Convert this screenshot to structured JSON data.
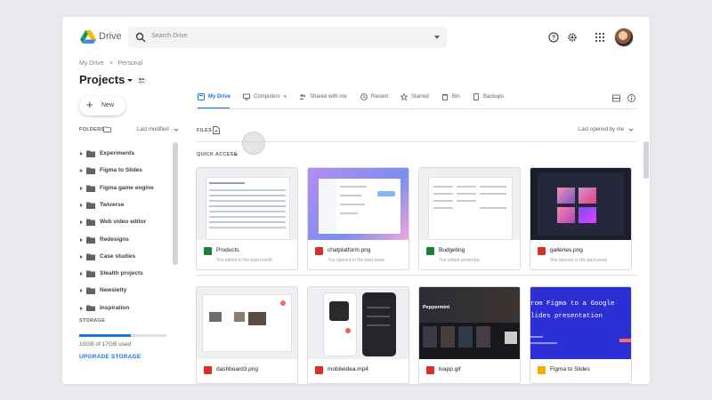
{
  "app": {
    "brand": "Drive",
    "search_placeholder": "Search Drive"
  },
  "toolbar": {
    "icons": [
      "help-icon",
      "settings-icon",
      "apps-grid-icon"
    ],
    "avatar": "user-avatar"
  },
  "breadcrumb": {
    "root": "My Drive",
    "separator": ">",
    "current": "Personal"
  },
  "page": {
    "title": "Projects"
  },
  "new_button": {
    "label": "New"
  },
  "sidebar": {
    "folders_header": "FOLDERS",
    "sort_label": "Last modified",
    "folders": [
      {
        "label": "Experiments"
      },
      {
        "label": "Figma to Slides"
      },
      {
        "label": "Figma game engine"
      },
      {
        "label": "Twiverse"
      },
      {
        "label": "Web video editor"
      },
      {
        "label": "Redesigns"
      },
      {
        "label": "Case studies"
      },
      {
        "label": "Stealth projects"
      },
      {
        "label": "Newsletty"
      },
      {
        "label": "Inspiration"
      }
    ],
    "storage_header": "STORAGE",
    "storage_used": "10GB of 17GB used",
    "storage_fraction": 0.59,
    "upgrade_label": "UPGRADE STORAGE"
  },
  "tabs": [
    {
      "label": "My Drive",
      "icon": "drive-icon",
      "active": true
    },
    {
      "label": "Computers",
      "icon": "computer-icon",
      "active": false
    },
    {
      "label": "Shared with me",
      "icon": "people-icon",
      "active": false
    },
    {
      "label": "Recent",
      "icon": "clock-icon",
      "active": false
    },
    {
      "label": "Starred",
      "icon": "star-icon",
      "active": false
    },
    {
      "label": "Bin",
      "icon": "bin-icon",
      "active": false
    },
    {
      "label": "Backups",
      "icon": "backup-icon",
      "active": false
    }
  ],
  "files_header": "FILES",
  "files_sort": "Last opened by me",
  "quick_access_header": "QUICK ACCESS",
  "quick_access": [
    {
      "name": "Products",
      "subtitle": "You edited in the past month",
      "type": "sheets",
      "color": "#188038"
    },
    {
      "name": "chatplatform.png",
      "subtitle": "You opened in the past week",
      "type": "image",
      "color": "#d93025"
    },
    {
      "name": "Budgeting",
      "subtitle": "You edited yesterday",
      "type": "sheets",
      "color": "#188038"
    },
    {
      "name": "galleries.png",
      "subtitle": "You opened in the past week",
      "type": "image",
      "color": "#d93025"
    }
  ],
  "files": [
    {
      "name": "dashboard3.png",
      "type": "image",
      "color": "#d93025"
    },
    {
      "name": "mobileidea.mp4",
      "type": "video",
      "color": "#d93025"
    },
    {
      "name": "tvapp.gif",
      "type": "image",
      "color": "#d93025"
    },
    {
      "name": "Figma to Slides",
      "type": "slides",
      "color": "#f9ab00"
    }
  ],
  "thumbnail_text": {
    "slides_line1": "rom Figma to a Google",
    "slides_line2": "lides presentation",
    "tvapp_title": "Peppermint"
  },
  "colors": {
    "accent": "#1a73e8",
    "background": "#e8eaf0"
  }
}
